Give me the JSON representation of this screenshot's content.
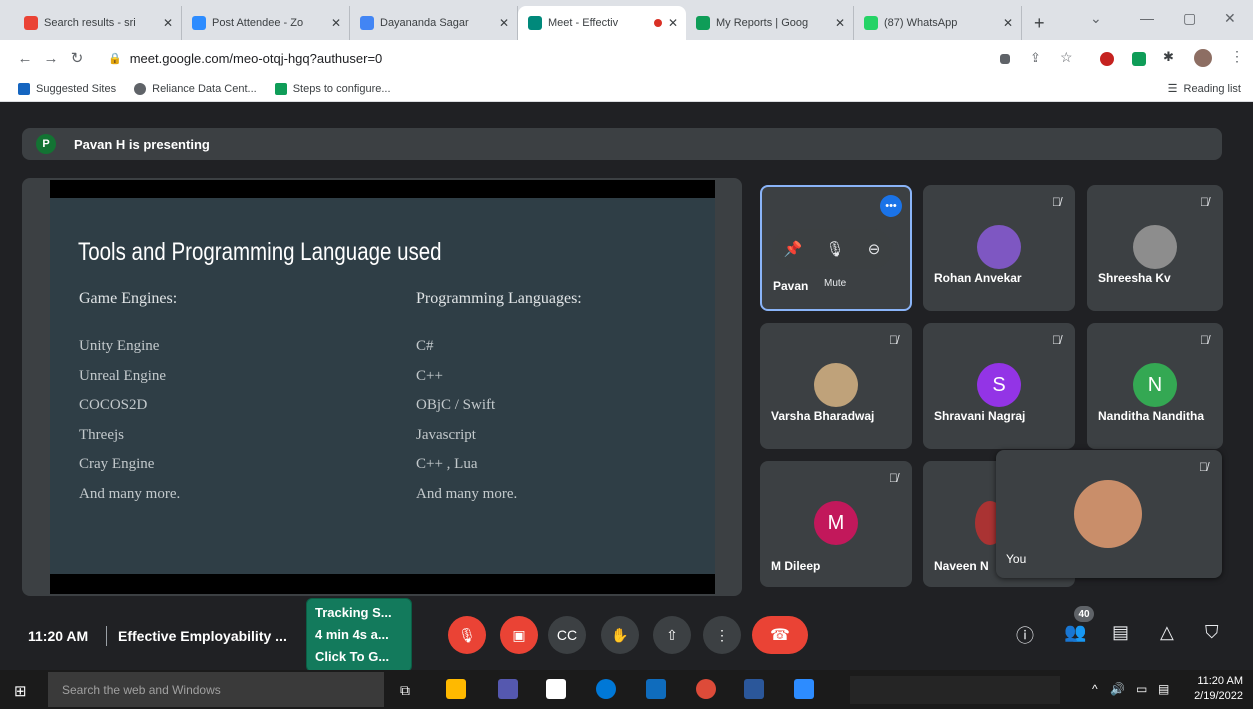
{
  "browser": {
    "tabs": [
      {
        "title": "Search results - sri",
        "icon": "mail-icon",
        "color": "#ea4335",
        "active": false
      },
      {
        "title": "Post Attendee - Zo",
        "icon": "zoom-icon",
        "color": "#2d8cff",
        "active": false
      },
      {
        "title": "Dayananda Sagar",
        "icon": "calendar-icon",
        "color": "#4285f4",
        "active": false
      },
      {
        "title": "Meet - Effectiv",
        "icon": "meet-icon",
        "color": "#00897b",
        "active": true
      },
      {
        "title": "My Reports | Goog",
        "icon": "forms-icon",
        "color": "#0f9d58",
        "active": false
      },
      {
        "title": "(87) WhatsApp",
        "icon": "whatsapp-icon",
        "color": "#25d366",
        "active": false
      }
    ],
    "url": "meet.google.com/meo-otqj-hgq?authuser=0",
    "bookmarks": [
      "Suggested Sites",
      "Reliance Data Cent...",
      "Steps to configure..."
    ],
    "reading_list": "Reading list"
  },
  "meet": {
    "presenting_initial": "P",
    "presenting_text": "Pavan H is presenting",
    "slide": {
      "title": "Tools and Programming Language used",
      "col1_head": "Game Engines:",
      "col1": [
        "Unity Engine",
        "Unreal Engine",
        "COCOS2D",
        "Threejs",
        "Cray Engine",
        "And many more."
      ],
      "col2_head": "Programming Languages:",
      "col2": [
        "C#",
        "C++",
        "OBjC / Swift",
        "Javascript",
        "C++ , Lua",
        "And many more."
      ]
    },
    "tiles": [
      {
        "name": "Pavan",
        "tooltip": "Mute"
      },
      {
        "name": "Rohan Anvekar"
      },
      {
        "name": "Shreesha Kv"
      },
      {
        "name": "Varsha Bharadwaj"
      },
      {
        "name": "Shravani Nagraj",
        "initial": "S",
        "color": "#9334e6"
      },
      {
        "name": "Nanditha Nanditha",
        "initial": "N",
        "color": "#34a853"
      },
      {
        "name": "M Dileep",
        "initial": "M",
        "color": "#c2185b"
      },
      {
        "name": "Naveen N"
      }
    ],
    "self_name": "You",
    "time": "11:20 AM",
    "meeting_title": "Effective Employability ...",
    "tracker_lines": [
      "Tracking S...",
      "4 min 4s a...",
      "Click To G..."
    ],
    "participant_count": "40"
  },
  "taskbar": {
    "search_placeholder": "Search the web and Windows",
    "clock_time": "11:20 AM",
    "clock_date": "2/19/2022"
  }
}
